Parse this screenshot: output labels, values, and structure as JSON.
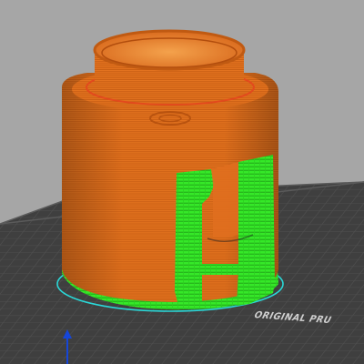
{
  "viewport": {
    "background": "#a6a6a6",
    "bed": {
      "label": "ORIGINAL PRU",
      "surface_color": "#3f3f3f",
      "grid_color": "#4f4f4f"
    },
    "model": {
      "wall_color": "#e06f1f",
      "support_color": "#33e626",
      "skirt_color": "#2ad7d7",
      "top_edge_color": "#e24a1d"
    },
    "axes": {
      "z_axis_color": "#1646d8"
    }
  }
}
